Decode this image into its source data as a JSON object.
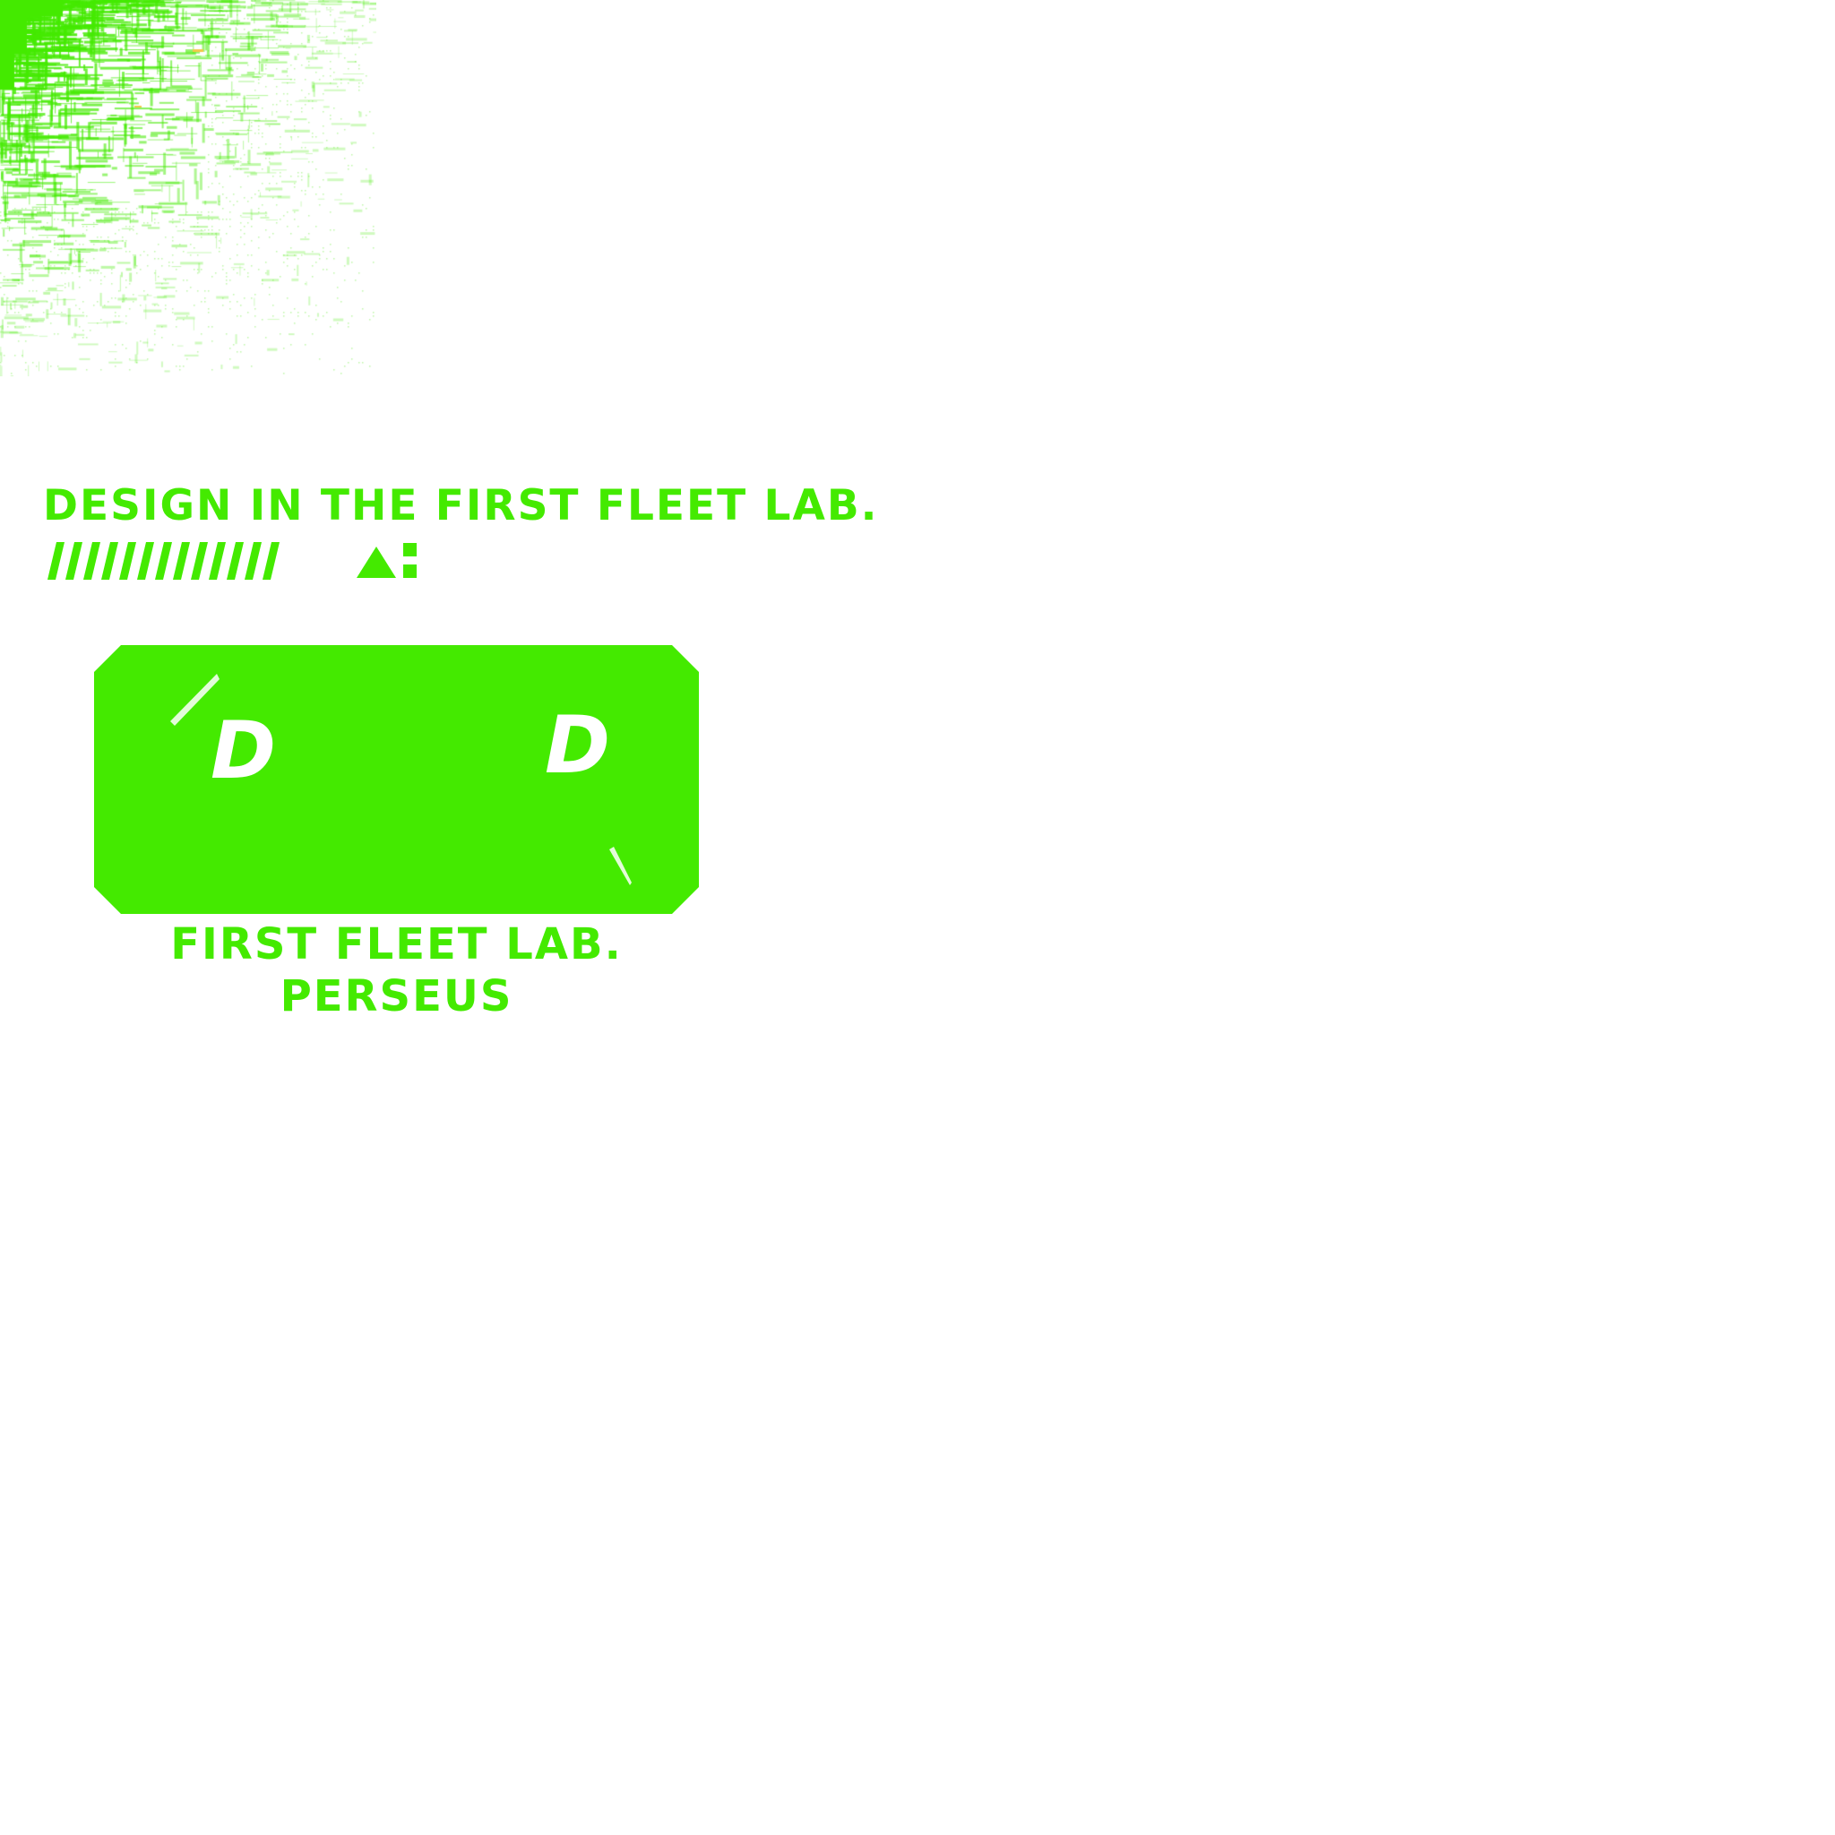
{
  "colors": {
    "accent": "#44ea00",
    "background": "#ffffff",
    "circuit_highlight": "#f2c84a"
  },
  "headline": "DESIGN IN THE FIRST FLEET LAB.",
  "logo": {
    "left_letter": "D",
    "right_letter": "D"
  },
  "footer": {
    "line1": "FIRST FLEET LAB.",
    "line2": "PERSEUS"
  },
  "decoration": {
    "stripe_count": 13,
    "icons": [
      "triangle-icon",
      "square-grid-icon"
    ]
  }
}
